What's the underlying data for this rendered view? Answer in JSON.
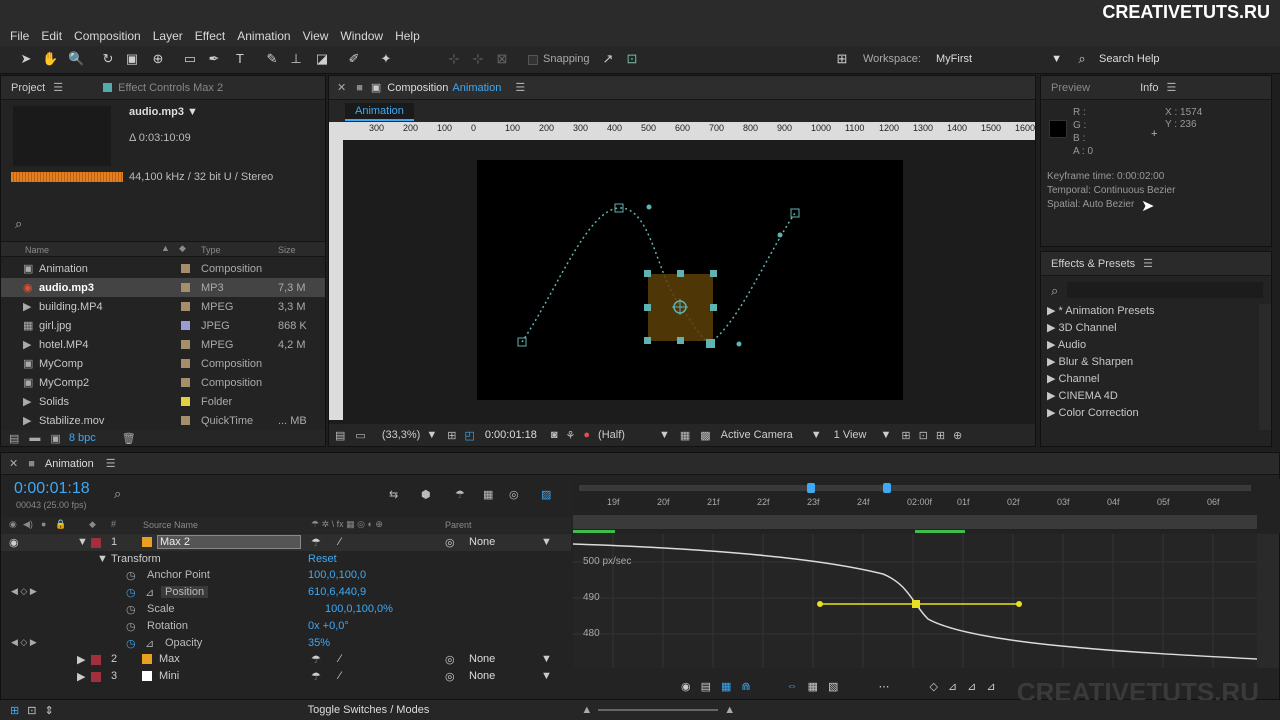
{
  "brand": "CREATIVETUTS.RU",
  "watermark": "CREATIVETUTS.RU",
  "menu": [
    "File",
    "Edit",
    "Composition",
    "Layer",
    "Effect",
    "Animation",
    "View",
    "Window",
    "Help"
  ],
  "toolbar": {
    "snapping": "Snapping",
    "workspace_label": "Workspace:",
    "workspace_value": "MyFirst",
    "search_help": "Search Help"
  },
  "project": {
    "tab_project": "Project",
    "tab_effects": "Effect Controls Max 2",
    "file_name": "audio.mp3 ▼",
    "duration": "Δ 0:03:10:09",
    "audio_info": "44,100 kHz / 32 bit U / Stereo",
    "columns": {
      "name": "Name",
      "type": "Type",
      "size": "Size"
    },
    "items": [
      {
        "name": "Animation",
        "type": "Composition",
        "size": "",
        "color": "#a58f6a",
        "icon": "composition-icon"
      },
      {
        "name": "audio.mp3",
        "type": "MP3",
        "size": "7,3 M",
        "color": "#a58f6a",
        "icon": "audio-icon"
      },
      {
        "name": "building.MP4",
        "type": "MPEG",
        "size": "3,3 M",
        "color": "#a58f6a",
        "icon": "video-icon"
      },
      {
        "name": "girl.jpg",
        "type": "JPEG",
        "size": "868 K",
        "color": "#9b9bd6",
        "icon": "image-icon"
      },
      {
        "name": "hotel.MP4",
        "type": "MPEG",
        "size": "4,2 M",
        "color": "#a58f6a",
        "icon": "video-icon"
      },
      {
        "name": "MyComp",
        "type": "Composition",
        "size": "",
        "color": "#a58f6a",
        "icon": "composition-icon"
      },
      {
        "name": "MyComp2",
        "type": "Composition",
        "size": "",
        "color": "#a58f6a",
        "icon": "composition-icon"
      },
      {
        "name": "Solids",
        "type": "Folder",
        "size": "",
        "color": "#e0d040",
        "icon": "folder-icon"
      },
      {
        "name": "Stabilize.mov",
        "type": "QuickTime",
        "size": "... MB",
        "color": "#a58f6a",
        "icon": "video-icon"
      }
    ],
    "bpc": "8 bpc"
  },
  "composition": {
    "tab": "Composition",
    "tab_name": "Animation",
    "sub_tab": "Animation",
    "ruler": [
      "300",
      "200",
      "100",
      "0",
      "100",
      "200",
      "300",
      "400",
      "500",
      "600",
      "700",
      "800",
      "900",
      "1000",
      "1100",
      "1200",
      "1300",
      "1400",
      "1500",
      "1600"
    ],
    "zoom": "(33,3%)",
    "timecode": "0:00:01:18",
    "resolution": "(Half)",
    "camera": "Active Camera",
    "view": "1 View"
  },
  "info": {
    "tab_preview": "Preview",
    "tab_info": "Info",
    "r": "R :",
    "g": "G :",
    "b": "B :",
    "a": "A : 0",
    "x": "X : 1574",
    "y": "Y : 236",
    "keyframe_time": "Keyframe time: 0:00:02:00",
    "temporal": "Temporal: Continuous Bezier",
    "spatial": "Spatial: Auto Bezier"
  },
  "effects": {
    "title": "Effects & Presets",
    "items": [
      "* Animation Presets",
      "3D Channel",
      "Audio",
      "Blur & Sharpen",
      "Channel",
      "CINEMA 4D",
      "Color Correction"
    ]
  },
  "timeline": {
    "tab": "Animation",
    "timecode": "0:00:01:18",
    "fps": "00043 (25.00 fps)",
    "col_source": "Source Name",
    "col_parent": "Parent",
    "layers": [
      {
        "num": "1",
        "name": "Max 2",
        "parent": "None",
        "color": "#e8a020"
      },
      {
        "num": "2",
        "name": "Max",
        "parent": "None",
        "color": "#e8a020"
      },
      {
        "num": "3",
        "name": "Mini",
        "parent": "None",
        "color": "#ffffff"
      }
    ],
    "transform": "Transform",
    "reset": "Reset",
    "props": [
      {
        "name": "Anchor Point",
        "value": "100,0,100,0"
      },
      {
        "name": "Position",
        "value": "610,6,440,9"
      },
      {
        "name": "Scale",
        "value": "100,0,100,0%"
      },
      {
        "name": "Rotation",
        "value": "0x +0,0°"
      },
      {
        "name": "Opacity",
        "value": "35%"
      }
    ],
    "ticks": [
      "19f",
      "20f",
      "21f",
      "22f",
      "23f",
      "24f",
      "02:00f",
      "01f",
      "02f",
      "03f",
      "04f",
      "05f",
      "06f"
    ],
    "graph_labels": [
      "500 px/sec",
      "490",
      "480"
    ],
    "toggle": "Toggle Switches / Modes"
  }
}
